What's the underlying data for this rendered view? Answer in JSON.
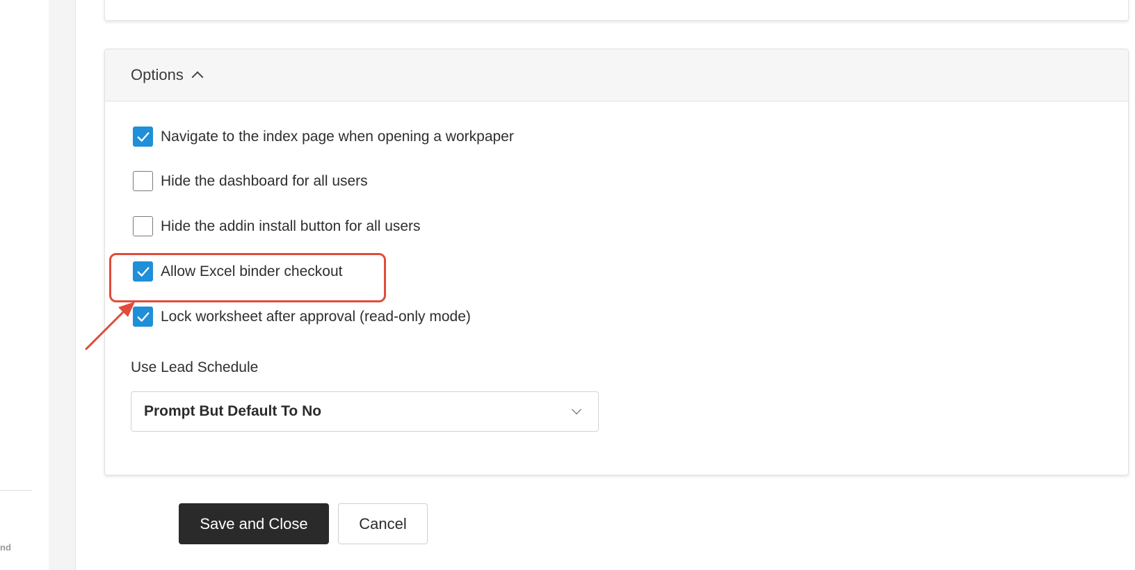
{
  "sidebar": {
    "partial_text": "nd"
  },
  "options": {
    "title": "Options",
    "items": [
      {
        "label": "Navigate to the index page when opening a workpaper",
        "checked": true
      },
      {
        "label": "Hide the dashboard for all users",
        "checked": false
      },
      {
        "label": "Hide the addin install button for all users",
        "checked": false
      },
      {
        "label": "Allow Excel binder checkout",
        "checked": true
      },
      {
        "label": "Lock worksheet after approval (read-only mode)",
        "checked": true
      }
    ],
    "lead_schedule": {
      "label": "Use Lead Schedule",
      "value": "Prompt But Default To No"
    }
  },
  "buttons": {
    "save_label": "Save and Close",
    "cancel_label": "Cancel"
  },
  "colors": {
    "accent": "#1e8fd8",
    "highlight": "#e14b3a",
    "primary_button": "#2a2a2a"
  },
  "icons": {
    "collapse": "chevron-up-icon",
    "dropdown": "chevron-down-icon",
    "check": "checkmark-icon"
  }
}
